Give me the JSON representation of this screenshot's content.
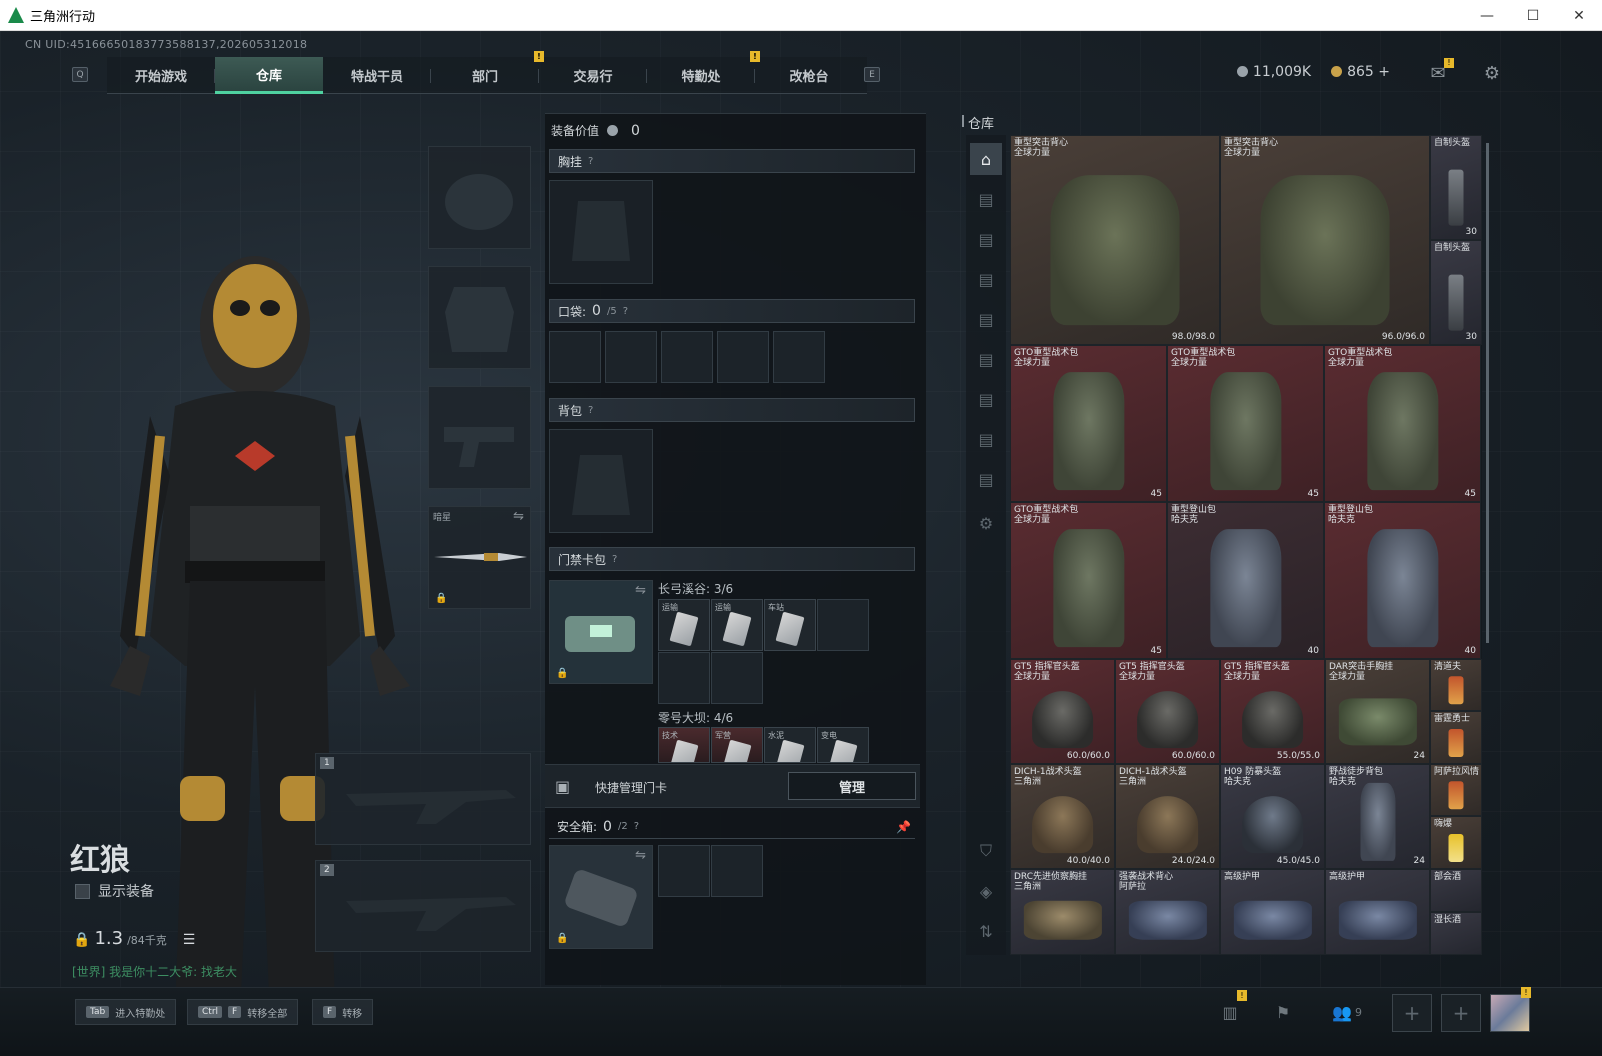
{
  "window": {
    "title": "三角洲行动",
    "minimize": "—",
    "maximize": "☐",
    "close": "✕"
  },
  "uid": "CN UID:451666501837735881​37,202605312018",
  "nav": {
    "key_left": "Q",
    "key_right": "E",
    "tabs": [
      {
        "label": "开始游戏",
        "active": false,
        "alert": ""
      },
      {
        "label": "仓库",
        "active": true,
        "alert": ""
      },
      {
        "label": "特战干员",
        "active": false,
        "alert": ""
      },
      {
        "label": "部门",
        "active": false,
        "alert": "!"
      },
      {
        "label": "交易行",
        "active": false,
        "alert": ""
      },
      {
        "label": "特勤处",
        "active": false,
        "alert": "!"
      },
      {
        "label": "改枪台",
        "active": false,
        "alert": ""
      }
    ]
  },
  "currency": {
    "silver": "11,009K",
    "gold": "865",
    "gold_add": "+"
  },
  "topicons": {
    "mail_alert": "!"
  },
  "character": {
    "name": "红狼",
    "show_equipment": "显示装备",
    "weight_value": "1.3",
    "weight_max": "/84千克",
    "chat": "[世界] 我是你十二大爷: 找老大"
  },
  "slots": {
    "melee_label": "暗星",
    "weapon1": "1",
    "weapon2": "2"
  },
  "equip": {
    "value_label": "装备价值",
    "value": "0",
    "chest": "胸挂",
    "pockets": "口袋: ",
    "pockets_val": "0",
    "pockets_max": "/5",
    "backpack": "背包",
    "keycard": "门禁卡包",
    "key_map1": "长弓溪谷: 3/6",
    "key_map1_items": [
      "运输",
      "运输",
      "车站"
    ],
    "key_map2": "零号大坝: 4/6",
    "key_map2_items": [
      "技术",
      "军营",
      "水泥",
      "变电"
    ],
    "quick_manage": "快捷管理门卡",
    "manage_btn": "管理",
    "safe": "安全箱: ",
    "safe_val": "0",
    "safe_max": "/2"
  },
  "stash": {
    "title": "仓库",
    "items": [
      {
        "name": "重型突击背心",
        "sub": "全球力量",
        "dur": "98.0/98.0"
      },
      {
        "name": "重型突击背心",
        "sub": "全球力量",
        "dur": "96.0/96.0"
      },
      {
        "name": "自制头盔",
        "sub": "",
        "cnt": "30"
      },
      {
        "name": "自制头盔",
        "sub": "",
        "cnt": "30"
      },
      {
        "name": "GTO重型战术包",
        "sub": "全球力量",
        "cnt": "45"
      },
      {
        "name": "GTO重型战术包",
        "sub": "全球力量",
        "cnt": "45"
      },
      {
        "name": "GTO重型战术包",
        "sub": "全球力量",
        "cnt": "45"
      },
      {
        "name": "GTO重型战术包",
        "sub": "全球力量",
        "cnt": "45"
      },
      {
        "name": "重型登山包",
        "sub": "哈夫克",
        "cnt": "40"
      },
      {
        "name": "重型登山包",
        "sub": "哈夫克",
        "cnt": "40"
      },
      {
        "name": "GT5 指挥官头盔",
        "sub": "全球力量",
        "dur": "60.0/60.0"
      },
      {
        "name": "GT5 指挥官头盔",
        "sub": "全球力量",
        "dur": "60.0/60.0"
      },
      {
        "name": "GT5 指挥官头盔",
        "sub": "全球力量",
        "dur": "55.0/55.0"
      },
      {
        "name": "DAR突击手胸挂",
        "sub": "全球力量",
        "cnt": "24"
      },
      {
        "name": "清道夫",
        "sub": ""
      },
      {
        "name": "雷霆勇士",
        "sub": ""
      },
      {
        "name": "DICH-1战术头盔",
        "sub": "三角洲",
        "dur": "40.0/40.0"
      },
      {
        "name": "DICH-1战术头盔",
        "sub": "三角洲",
        "dur": "24.0/24.0"
      },
      {
        "name": "H09 防暴头盔",
        "sub": "哈夫克",
        "dur": "45.0/45.0"
      },
      {
        "name": "野战徒步背包",
        "sub": "哈夫克",
        "cnt": "24"
      },
      {
        "name": "阿萨拉风情",
        "sub": ""
      },
      {
        "name": "嗨爆",
        "sub": ""
      },
      {
        "name": "DRC先进侦察胸挂",
        "sub": "三角洲"
      },
      {
        "name": "强袭战术背心",
        "sub": "阿萨拉"
      },
      {
        "name": "高级护甲",
        "sub": ""
      },
      {
        "name": "高级护甲",
        "sub": ""
      },
      {
        "name": "部会酒",
        "sub": ""
      },
      {
        "name": "湿长酒",
        "sub": ""
      }
    ]
  },
  "bottom": {
    "tab_key": "Tab",
    "tab_label": "进入特勤处",
    "ctrl_key": "Ctrl",
    "f_key": "F",
    "transfer_all": "转移全部",
    "f_key2": "F",
    "transfer": "转移",
    "friends_count": "9",
    "alert1": "!",
    "alert2": "!"
  }
}
